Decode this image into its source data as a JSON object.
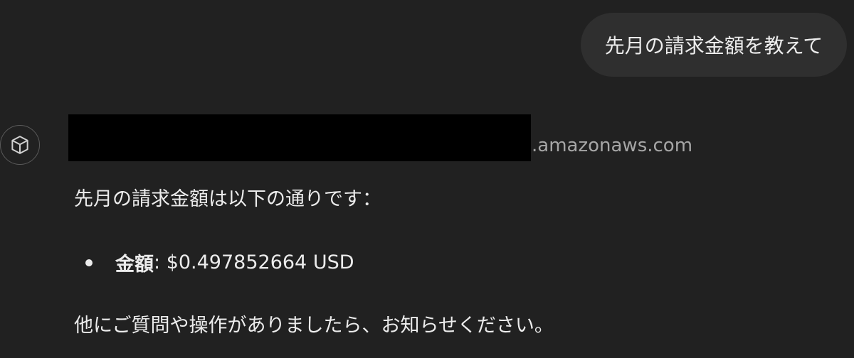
{
  "user_message": {
    "text": "先月の請求金額を教えて"
  },
  "assistant": {
    "avatar_icon": "cube-icon",
    "source_host_suffix": ".amazonaws.com",
    "intro": "先月の請求金額は以下の通りです：",
    "items": [
      {
        "key": "金額",
        "separator": ": ",
        "value": "$0.497852664 USD"
      }
    ],
    "closing": "他にご質問や操作がありましたら、お知らせください。"
  },
  "colors": {
    "background": "#212121",
    "user_bubble": "#2f2f2f",
    "text": "#ececec",
    "muted_text": "#a6a6a6",
    "redaction": "#000000"
  }
}
